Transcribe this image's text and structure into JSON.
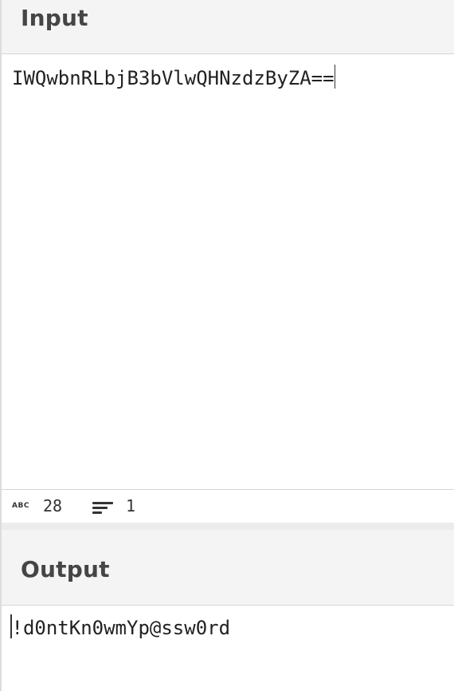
{
  "input": {
    "title": "Input",
    "value": "IWQwbnRLbjB3bVlwQHNzdzByZA=="
  },
  "status": {
    "length_icon": "abc-count-icon",
    "length_icon_text": "ABC",
    "length": "28",
    "lines_icon": "lines-icon",
    "lines": "1"
  },
  "output": {
    "title": "Output",
    "value": "!d0ntKn0wmYp@ssw0rd"
  }
}
